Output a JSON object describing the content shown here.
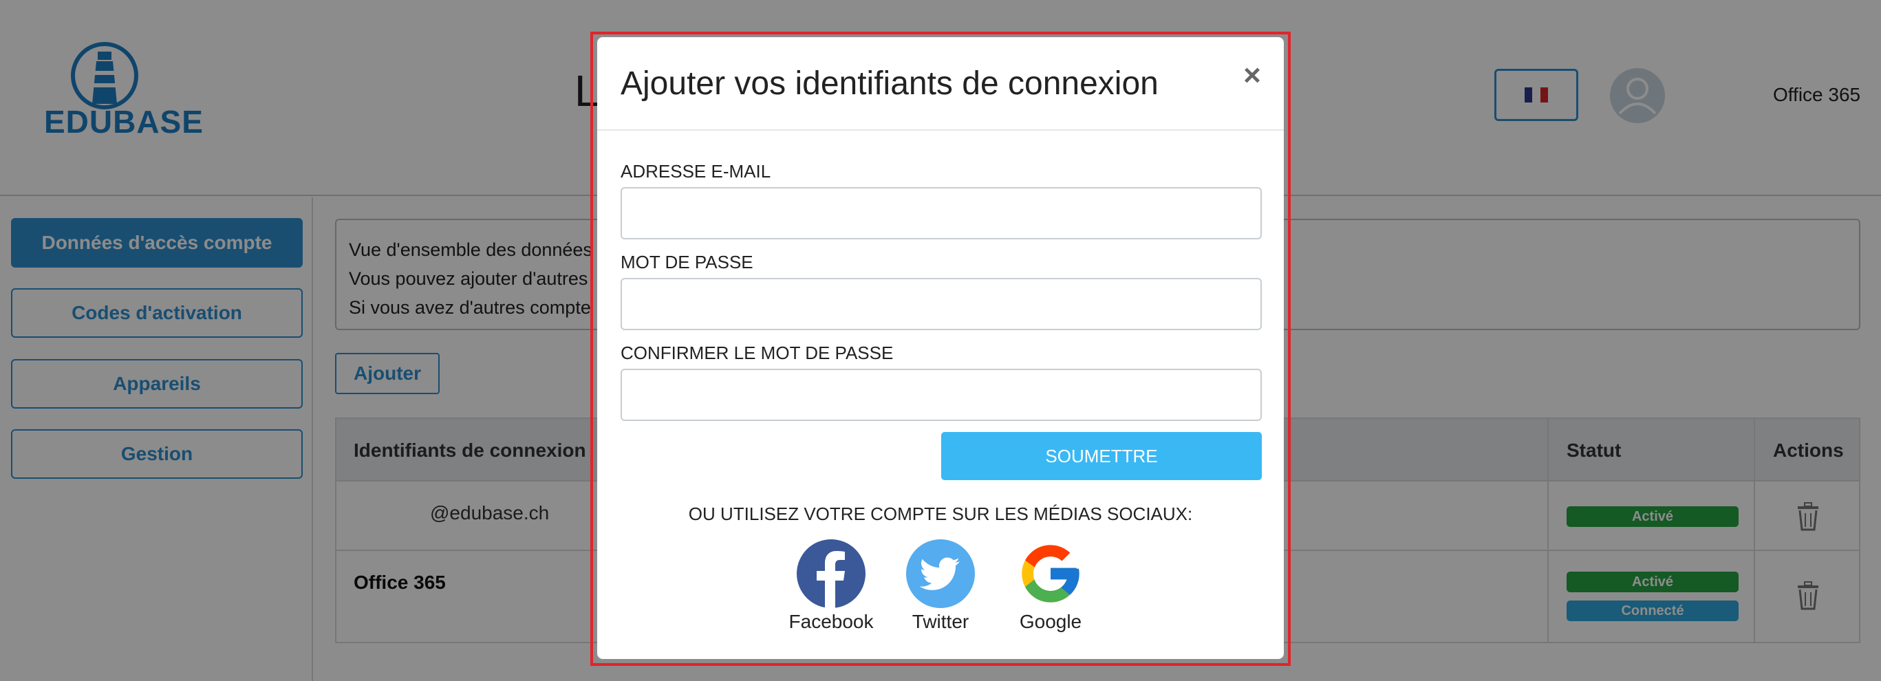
{
  "header": {
    "logo_text": "EDUBASE",
    "page_title": "L",
    "right_label": "Office 365"
  },
  "sidebar": {
    "items": [
      {
        "label": "Données d'accès compte",
        "active": true
      },
      {
        "label": "Codes d'activation"
      },
      {
        "label": "Appareils"
      },
      {
        "label": "Gestion"
      }
    ]
  },
  "main": {
    "info_lines": [
      "Vue d'ensemble des données",
      "Vous pouvez ajouter d'autres",
      "Si vous avez d'autres compte"
    ],
    "add_button": "Ajouter",
    "table": {
      "headers": [
        "Identifiants de connexion",
        "Statut",
        "Actions"
      ],
      "rows": [
        {
          "login": "@edubase.ch",
          "badges": [
            "Activé"
          ]
        },
        {
          "login": "Office 365",
          "badges": [
            "Activé",
            "Connecté"
          ]
        }
      ]
    }
  },
  "modal": {
    "title": "Ajouter vos identifiants de connexion",
    "close": "×",
    "email_label": "ADRESSE E-MAIL",
    "email_value": "",
    "password_label": "MOT DE PASSE",
    "password_value": "",
    "confirm_label": "CONFIRMER LE MOT DE PASSE",
    "confirm_value": "",
    "submit": "SOUMETTRE",
    "social_label": "OU UTILISEZ VOTRE COMPTE SUR LES MÉDIAS SOCIAUX:",
    "social": [
      {
        "name": "Facebook",
        "icon": "facebook-icon"
      },
      {
        "name": "Twitter",
        "icon": "twitter-icon"
      },
      {
        "name": "Google",
        "icon": "google-icon"
      }
    ]
  },
  "colors": {
    "brand": "#2f8fce",
    "submit": "#3ab8f4",
    "status_active": "#27a243",
    "status_connected": "#2fa6db",
    "highlight_frame": "#e1242b"
  }
}
